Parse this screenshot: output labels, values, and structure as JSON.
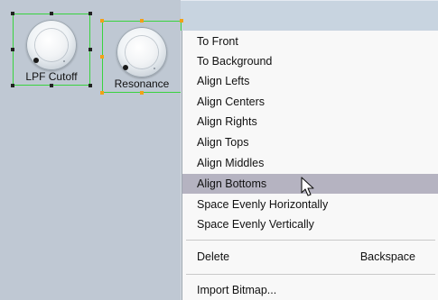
{
  "widgets": [
    {
      "label": "LPF Cutoff"
    },
    {
      "label": "Resonance"
    }
  ],
  "context_menu": {
    "items": [
      {
        "label": "To Front"
      },
      {
        "label": "To Background"
      },
      {
        "label": "Align Lefts"
      },
      {
        "label": "Align Centers"
      },
      {
        "label": "Align Rights"
      },
      {
        "label": "Align Tops"
      },
      {
        "label": "Align Middles"
      },
      {
        "label": "Align Bottoms",
        "highlighted": true
      },
      {
        "label": "Space Evenly Horizontally"
      },
      {
        "label": "Space Evenly Vertically"
      }
    ],
    "delete_item": {
      "label": "Delete",
      "shortcut": "Backspace"
    },
    "import_item": {
      "label": "Import Bitmap..."
    }
  },
  "colors": {
    "selection_border": "#39d33f",
    "handle_primary": "#222222",
    "handle_secondary": "#f2a117",
    "menu_highlight": "#b5b3c1",
    "canvas_background": "#bfc8d3"
  },
  "icons": {
    "cursor": "arrow-pointer-icon"
  }
}
